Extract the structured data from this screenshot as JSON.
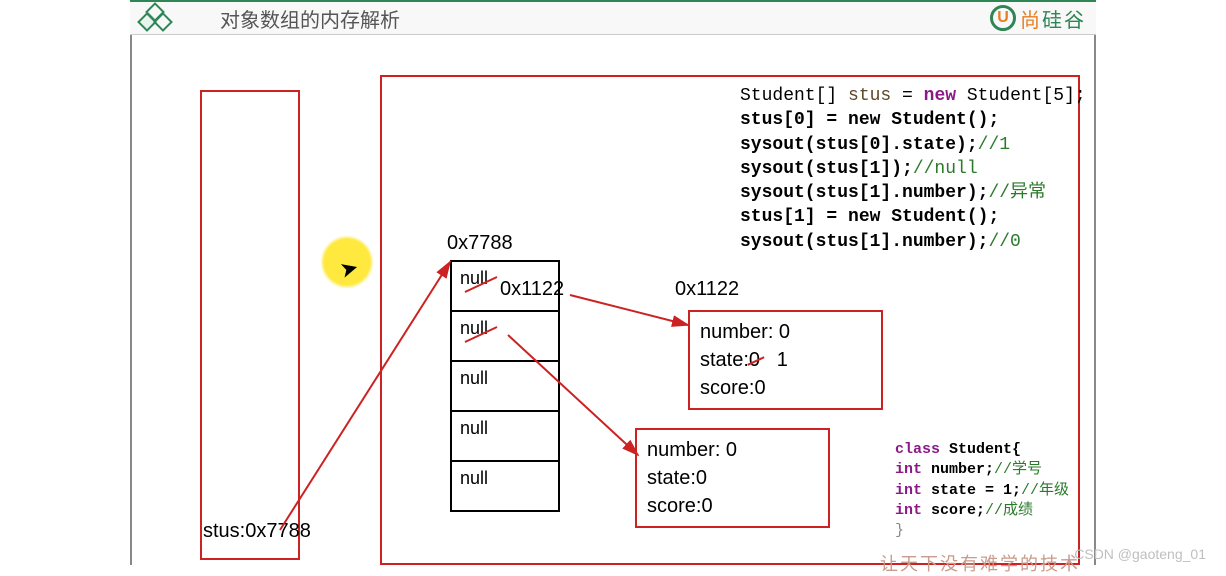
{
  "header": {
    "title": "对象数组的内存解析",
    "brand_letter": "U",
    "brand_chars": [
      "尚",
      "硅",
      "谷"
    ]
  },
  "stack": {
    "stus_label": "stus:0x7788"
  },
  "heap": {
    "array_addr": "0x7788",
    "ref_addr_small": "0x1122",
    "ref_addr_label": "0x1122",
    "cells": [
      "null",
      "null",
      "null",
      "null",
      "null"
    ],
    "obj1": {
      "l1": "number: 0",
      "l2a": "state:",
      "l2_strike": "0",
      "l2_new": "1",
      "l3": "score:0"
    },
    "obj2": {
      "l1": "number: 0",
      "l2": "state:0",
      "l3": "score:0"
    }
  },
  "code1": {
    "l1_a": "Student[] ",
    "l1_var": "stus",
    "l1_b": " = ",
    "l1_kw": "new",
    "l1_c": " Student[5];",
    "l2": "stus[0] = new Student();",
    "l3": "sysout(stus[0].state);",
    "l3c": "//1",
    "l4": "sysout(stus[1]);",
    "l4c": "//null",
    "l5": "sysout(stus[1].number);",
    "l5c": "//异常",
    "l6": "stus[1] = new Student();",
    "l7": "sysout(stus[1].number);",
    "l7c": "//0"
  },
  "code2": {
    "l1_kw": "class",
    "l1_b": " Student{",
    "l2_kw": "int",
    "l2_b": " number;",
    "l2c": "//学号",
    "l3_kw": "int",
    "l3_b": " state = 1;",
    "l3c": "//年级",
    "l4_kw": "int",
    "l4_b": " score;",
    "l4c": "//成绩",
    "l5": "}"
  },
  "tagline": "让天下没有难学的技术",
  "watermark": "CSDN @gaoteng_01"
}
